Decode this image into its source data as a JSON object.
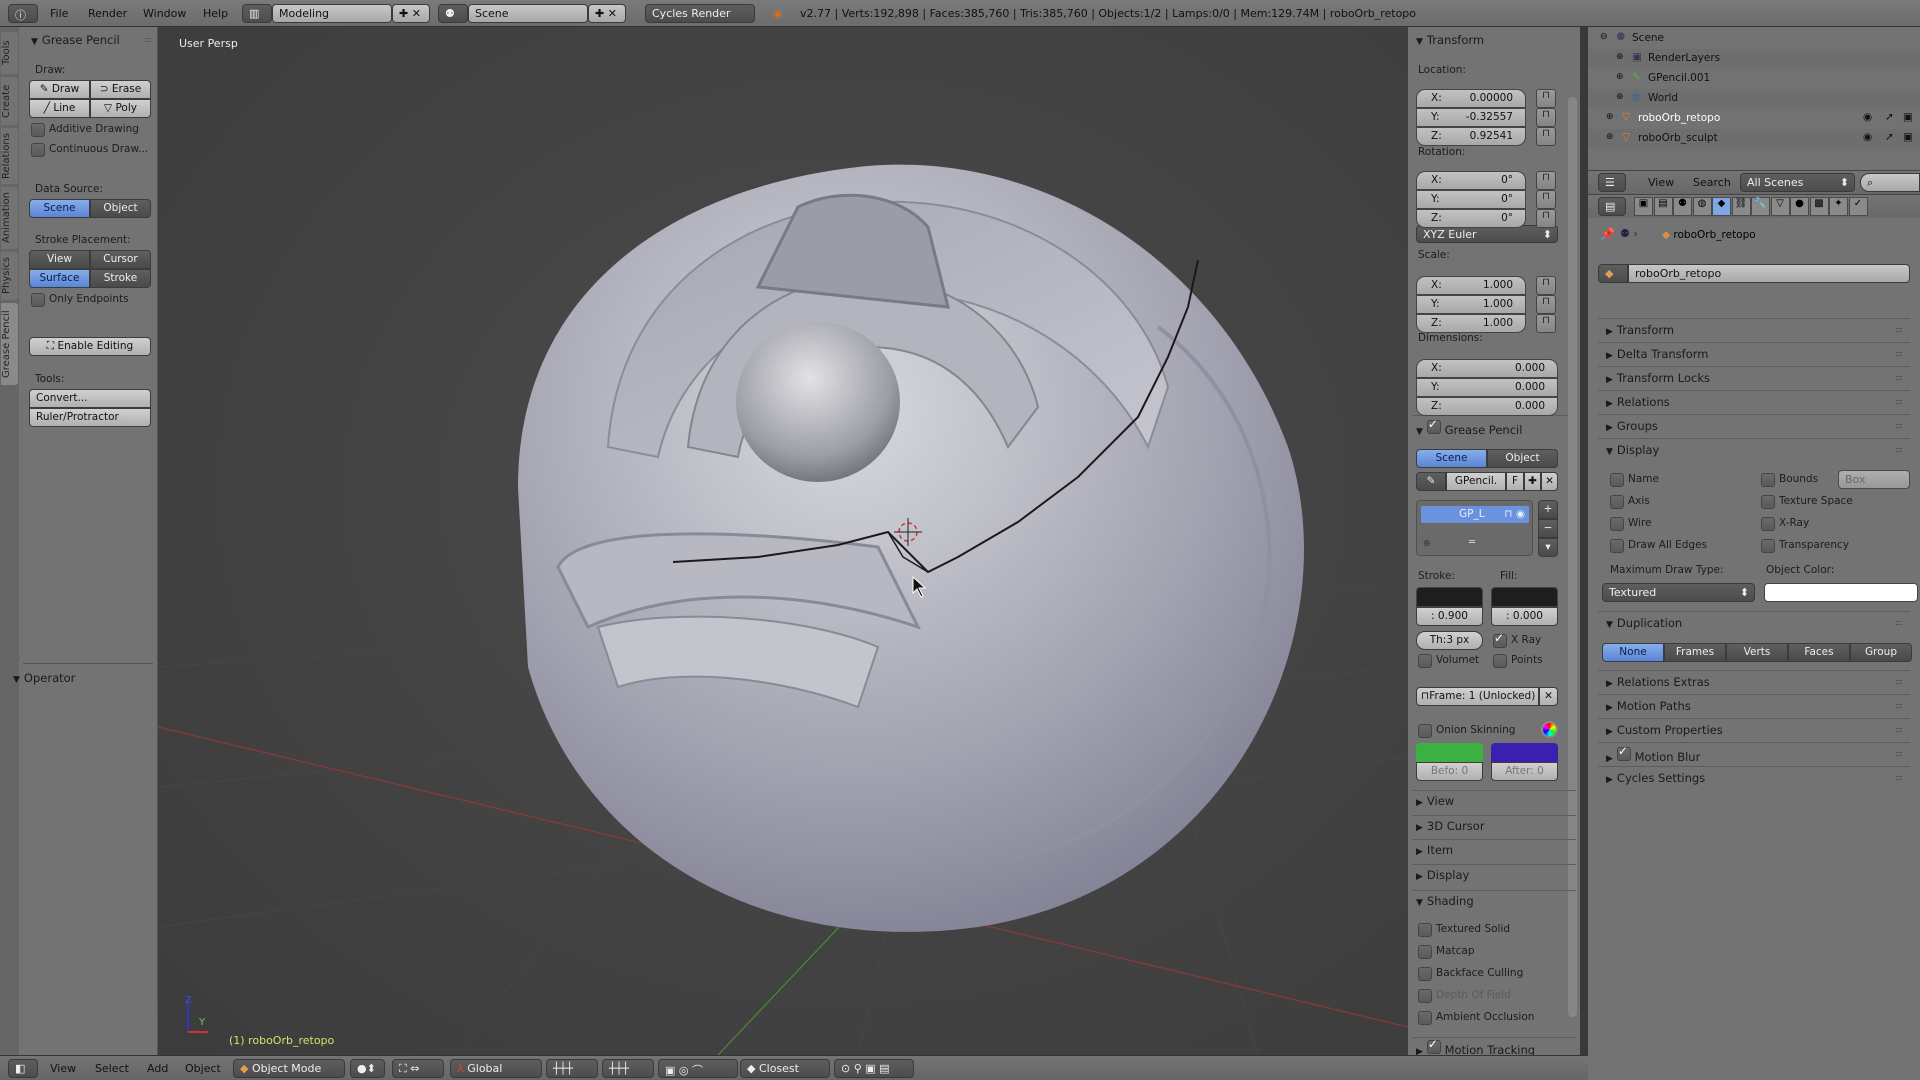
{
  "topbar": {
    "menus": [
      "File",
      "Render",
      "Window",
      "Help"
    ],
    "layout": "Modeling",
    "scene": "Scene",
    "engine": "Cycles Render",
    "stats": "v2.77 | Verts:192,898 | Faces:385,760 | Tris:385,760 | Objects:1/2 | Lamps:0/0 | Mem:129.74M | roboOrb_retopo"
  },
  "tabs": [
    "Tools",
    "Create",
    "Relations",
    "Animation",
    "Physics",
    "Grease Pencil"
  ],
  "shelf": {
    "title": "Grease Pencil",
    "draw_label": "Draw:",
    "draw": "Draw",
    "erase": "Erase",
    "line": "Line",
    "poly": "Poly",
    "additive": "Additive Drawing",
    "continuous": "Continuous Draw...",
    "data_source_label": "Data Source:",
    "scene": "Scene",
    "object": "Object",
    "stroke_placement_label": "Stroke Placement:",
    "view": "View",
    "cursor": "Cursor",
    "surface": "Surface",
    "stroke": "Stroke",
    "only_endpoints": "Only Endpoints",
    "enable_editing": "Enable Editing",
    "tools_label": "Tools:",
    "convert": "Convert...",
    "ruler": "Ruler/Protractor",
    "operator": "Operator"
  },
  "viewport": {
    "view_name": "User Persp",
    "object_info": "(1) roboOrb_retopo",
    "axis_z": "Z",
    "axis_y": "Y"
  },
  "npanel": {
    "transform": "Transform",
    "location_label": "Location:",
    "location": [
      {
        "k": "X:",
        "v": "0.00000"
      },
      {
        "k": "Y:",
        "v": "-0.32557"
      },
      {
        "k": "Z:",
        "v": "0.92541"
      }
    ],
    "rotation_label": "Rotation:",
    "rotation": [
      {
        "k": "X:",
        "v": "0°"
      },
      {
        "k": "Y:",
        "v": "0°"
      },
      {
        "k": "Z:",
        "v": "0°"
      }
    ],
    "rotation_mode": "XYZ Euler",
    "scale_label": "Scale:",
    "scale": [
      {
        "k": "X:",
        "v": "1.000"
      },
      {
        "k": "Y:",
        "v": "1.000"
      },
      {
        "k": "Z:",
        "v": "1.000"
      }
    ],
    "dimensions_label": "Dimensions:",
    "dimensions": [
      {
        "k": "X:",
        "v": "0.000"
      },
      {
        "k": "Y:",
        "v": "0.000"
      },
      {
        "k": "Z:",
        "v": "0.000"
      }
    ],
    "gp_title": "Grease Pencil",
    "gp_scene": "Scene",
    "gp_object": "Object",
    "gp_name": "GPencil.",
    "gp_f": "F",
    "layer": "GP_L",
    "stroke_label": "Stroke:",
    "fill_label": "Fill:",
    "stroke_value": ": 0.900",
    "fill_value": ": 0.000",
    "thickness": "Th:3 px",
    "xray": "X Ray",
    "volumetric": "Volumet",
    "points": "Points",
    "frame": "Frame: 1 (Unlocked)",
    "onion": "Onion Skinning",
    "before": "Befo: 0",
    "after": "After: 0",
    "stroke_color": "#1e1e1e",
    "fill_color": "#1e1e1e",
    "before_color": "#3cb043",
    "after_color": "#3a1fb0",
    "collapsed": [
      "View",
      "3D Cursor",
      "Item",
      "Display"
    ],
    "shading": "Shading",
    "shading_opts": [
      "Textured Solid",
      "Matcap",
      "Backface Culling",
      "Depth Of Field",
      "Ambient Occlusion"
    ],
    "motion_tracking": "Motion Tracking"
  },
  "outliner": {
    "rows": [
      "Scene",
      "RenderLayers",
      "GPencil.001",
      "World",
      "roboOrb_retopo",
      "roboOrb_sculpt"
    ],
    "view": "View",
    "search": "Search",
    "filter": "All Scenes"
  },
  "properties": {
    "breadcrumb": "roboOrb_retopo",
    "object_name": "roboOrb_retopo",
    "panels_top": [
      "Transform",
      "Delta Transform",
      "Transform Locks",
      "Relations",
      "Groups"
    ],
    "display": "Display",
    "display_left": [
      "Name",
      "Axis",
      "Wire",
      "Draw All Edges"
    ],
    "display_right": [
      "Bounds",
      "Texture Space",
      "X-Ray",
      "Transparency"
    ],
    "bounds_type": "Box",
    "max_draw_label": "Maximum Draw Type:",
    "max_draw": "Textured",
    "object_color_label": "Object Color:",
    "object_color": "#ffffff",
    "duplication": "Duplication",
    "dup_options": [
      "None",
      "Frames",
      "Verts",
      "Faces",
      "Group"
    ],
    "panels_bottom": [
      "Relations Extras",
      "Motion Paths",
      "Custom Properties",
      "Motion Blur",
      "Cycles Settings"
    ]
  },
  "bottombar": {
    "menus": [
      "View",
      "Select",
      "Add",
      "Object"
    ],
    "mode": "Object Mode",
    "orientation": "Global",
    "snap": "Closest"
  },
  "colors": {
    "accent": "#5a84d6",
    "object_text": "#c8e86a"
  }
}
